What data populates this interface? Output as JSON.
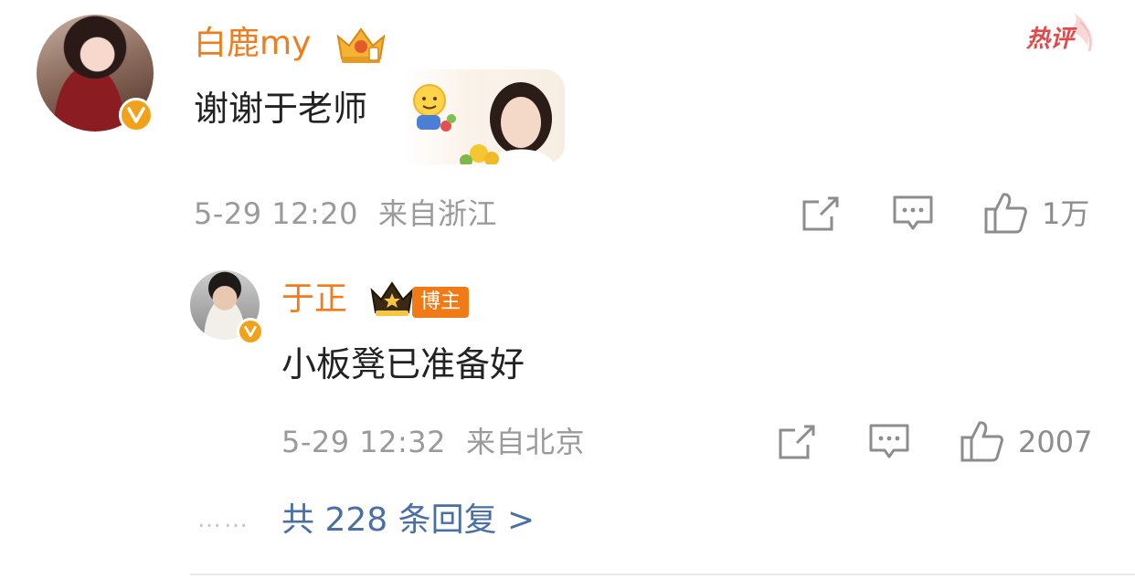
{
  "hot_label": "热评",
  "comment": {
    "author": "白鹿my",
    "text": "谢谢于老师",
    "timestamp": "5-29 12:20",
    "location": "来自浙江",
    "likes": "1万"
  },
  "reply": {
    "author": "于正",
    "badge": "博主",
    "text": "小板凳已准备好",
    "timestamp": "5-29 12:32",
    "location": "来自北京",
    "likes": "2007"
  },
  "more_replies": "共 228 条回复 >",
  "dots": "……",
  "colors": {
    "name": "#ef7c1d",
    "link": "#4a6fa5",
    "meta": "#9a9a9a",
    "verified": "#f2a21a",
    "hot": "#e04a4a"
  },
  "icons": [
    "verified-icon",
    "crown-icon",
    "share-icon",
    "comment-icon",
    "like-icon",
    "emoji-icon"
  ]
}
